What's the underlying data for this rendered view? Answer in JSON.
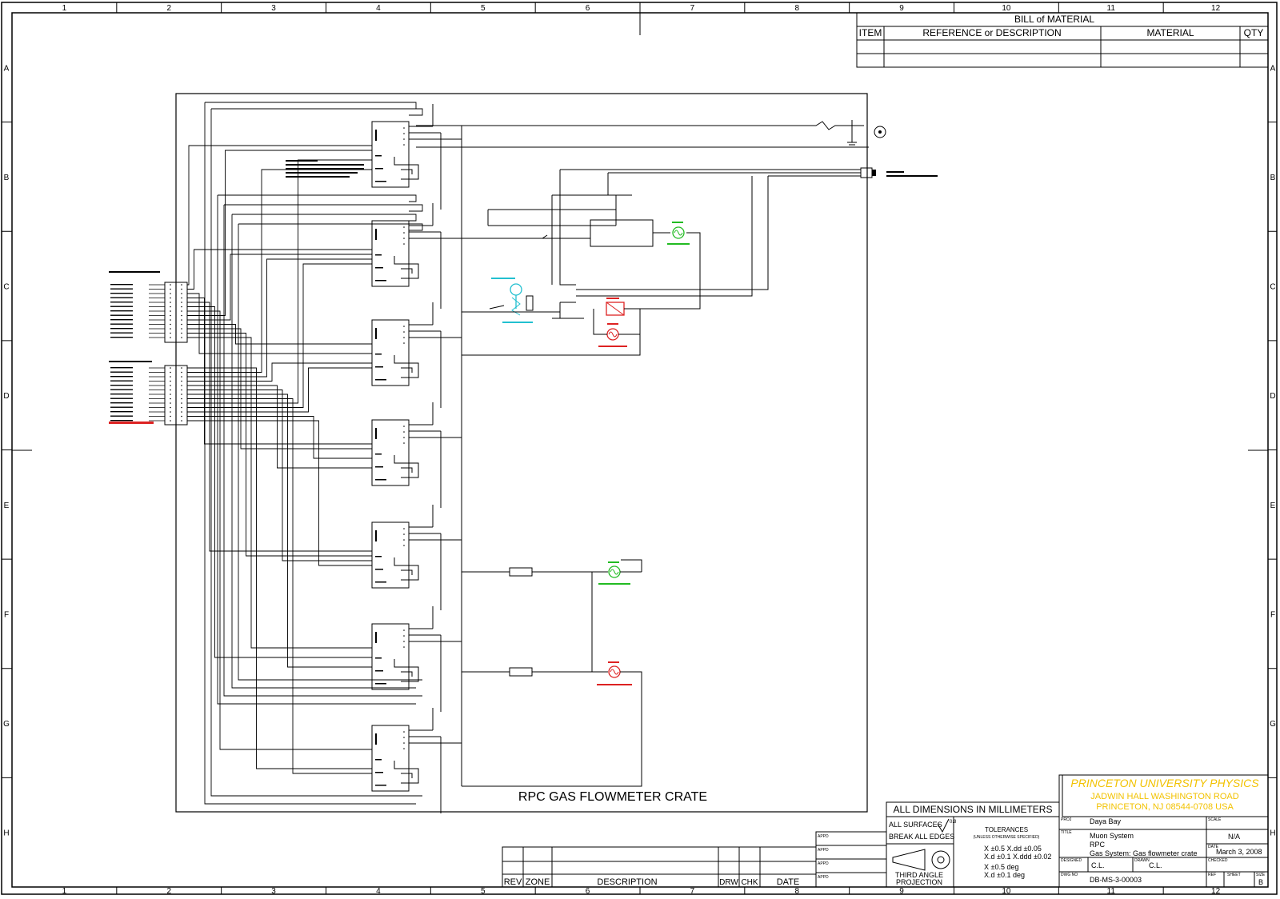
{
  "sheet": {
    "col_labels": [
      "1",
      "2",
      "3",
      "4",
      "5",
      "6",
      "7",
      "8",
      "9",
      "10",
      "11",
      "12"
    ],
    "row_labels": [
      "A",
      "B",
      "C",
      "D",
      "E",
      "F",
      "G",
      "H"
    ]
  },
  "bom": {
    "title": "BILL of MATERIAL",
    "col_item": "ITEM",
    "col_ref": "REFERENCE or DESCRIPTION",
    "col_material": "MATERIAL",
    "col_qty": "QTY"
  },
  "crate": {
    "title": "RPC GAS FLOWMETER CRATE"
  },
  "revision": {
    "rev": "REV",
    "zone": "ZONE",
    "description": "DESCRIPTION",
    "drw": "DRW",
    "chk": "CHK",
    "date": "DATE",
    "appd_1": "APPD",
    "appd_2": "APPD",
    "appd_3": "APPD",
    "appd_4": "APPD"
  },
  "title_block": {
    "dimensions_note": "ALL DIMENSIONS IN MILLIMETERS",
    "surfaces_1": "ALL SURFACES",
    "surface_finish": "0.8",
    "surfaces_2": "BREAK ALL EDGES",
    "tolerances": "TOLERANCES",
    "tolerances_note": "(UNLESS OTHERWISE SPECIFIED)",
    "tol_linear_1": "X ±0.5   X.dd ±0.05",
    "tol_linear_2": "X.d ±0.1   X.ddd ±0.02",
    "tol_angular_1": "X ±0.5 deg",
    "tol_angular_2": "X.d ±0.1 deg",
    "projection_1": "THIRD ANGLE",
    "projection_2": "PROJECTION",
    "org_name": "PRINCETON UNIVERSITY PHYSICS",
    "org_address_1": "JADWIN HALL    WASHINGTON ROAD",
    "org_address_2": "PRINCETON, NJ  08544-0708  USA",
    "project_label": "PROJ",
    "project": "Daya Bay",
    "title_label": "TITLE",
    "title_line_1": "Muon System",
    "title_line_2": "RPC",
    "title_line_3": "Gas System: Gas flowmeter crate",
    "scale_label": "SCALE",
    "scale": "N/A",
    "date_label": "DATE",
    "date": "March 3, 2008",
    "designed_label": "DESIGNED",
    "designed": "C.L.",
    "drawn_label": "DRAWN",
    "drawn": "C.L.",
    "checked_label": "CHECKED",
    "drawing_no_label": "DWG NO",
    "drawing_no": "DB-MS-3-00003",
    "ref_label": "REF",
    "sheet_label": "SHEET",
    "size_label": "SIZE",
    "size": "B"
  },
  "colors": {
    "line": "#000000",
    "org_text": "#f2c200",
    "green_lamp": "#22bb22",
    "red_lamp": "#dd2222",
    "cyan_sensor": "#22c0d0"
  }
}
